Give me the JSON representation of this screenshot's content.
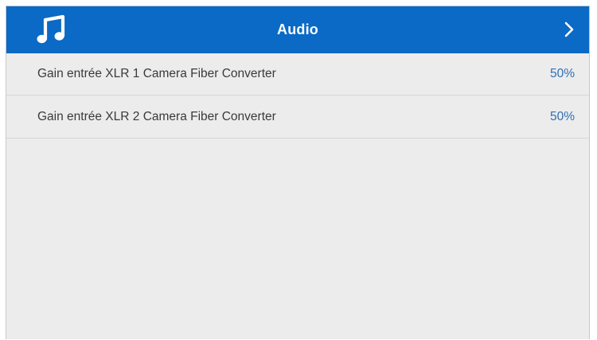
{
  "header": {
    "title": "Audio",
    "icon": "music-note-icon",
    "next_icon": "chevron-right-icon",
    "accent_color": "#0a6ac6"
  },
  "settings": [
    {
      "label": "Gain entrée XLR 1 Camera Fiber Converter",
      "value": "50%"
    },
    {
      "label": "Gain entrée XLR 2 Camera Fiber Converter",
      "value": "50%"
    }
  ],
  "colors": {
    "background": "#ececec",
    "value_text": "#2f6fb5",
    "label_text": "#3a3a3a"
  }
}
